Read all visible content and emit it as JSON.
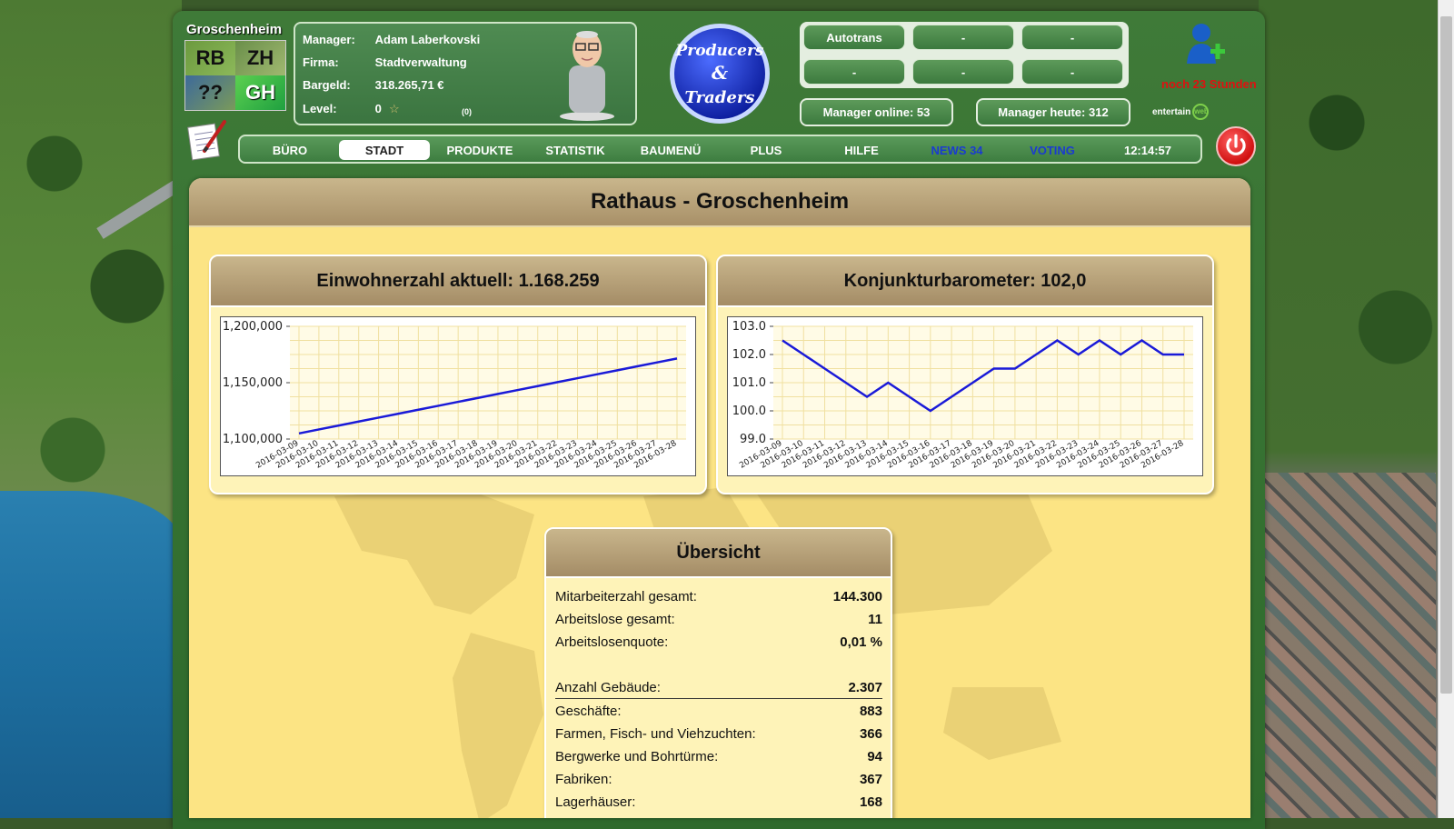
{
  "city": {
    "name": "Groschenheim",
    "grid": [
      "RB",
      "ZH",
      "??",
      "GH"
    ]
  },
  "manager": {
    "manager_label": "Manager:",
    "manager_value": "Adam Laberkovski",
    "firma_label": "Firma:",
    "firma_value": "Stadtverwaltung",
    "bargeld_label": "Bargeld:",
    "bargeld_value": "318.265,71 €",
    "level_label": "Level:",
    "level_value": "0",
    "level_count": "(0)"
  },
  "logo": {
    "line1": "Producers",
    "line2": "&",
    "line3": "Traders"
  },
  "top_buttons": [
    "Autotrans",
    "-",
    "-",
    "-",
    "-",
    "-"
  ],
  "stats": {
    "online_label": "Manager online:",
    "online_value": "53",
    "today_label": "Manager heute:",
    "today_value": "312"
  },
  "countdown": "noch 23 Stunden",
  "entertain": "entertain",
  "entertain_badge": "web",
  "nav": {
    "items": [
      "BÜRO",
      "STADT",
      "PRODUKTE",
      "STATISTIK",
      "BAUMENÜ",
      "PLUS",
      "HILFE",
      "NEWS 34",
      "VOTING"
    ],
    "time": "12:14:57"
  },
  "page_title": "Rathaus - Groschenheim",
  "chart_data": [
    {
      "type": "line",
      "title": "Einwohnerzahl aktuell: 1.168.259",
      "x": [
        "2016-03-09",
        "2016-03-10",
        "2016-03-11",
        "2016-03-12",
        "2016-03-13",
        "2016-03-14",
        "2016-03-15",
        "2016-03-16",
        "2016-03-17",
        "2016-03-18",
        "2016-03-19",
        "2016-03-20",
        "2016-03-21",
        "2016-03-22",
        "2016-03-23",
        "2016-03-24",
        "2016-03-25",
        "2016-03-26",
        "2016-03-27",
        "2016-03-28"
      ],
      "values": [
        1105000,
        1108500,
        1112000,
        1115500,
        1119000,
        1122500,
        1126000,
        1129500,
        1133000,
        1136500,
        1140000,
        1143500,
        1147000,
        1150500,
        1154000,
        1157500,
        1161000,
        1164500,
        1168000,
        1171500
      ],
      "yticks": [
        "1,100,000",
        "1,150,000",
        "1,200,000"
      ],
      "ylim": [
        1100000,
        1200000
      ],
      "grid": true,
      "line_color": "#1a1ad8"
    },
    {
      "type": "line",
      "title": "Konjunkturbarometer: 102,0",
      "x": [
        "2016-03-09",
        "2016-03-10",
        "2016-03-11",
        "2016-03-12",
        "2016-03-13",
        "2016-03-14",
        "2016-03-15",
        "2016-03-16",
        "2016-03-17",
        "2016-03-18",
        "2016-03-19",
        "2016-03-20",
        "2016-03-21",
        "2016-03-22",
        "2016-03-23",
        "2016-03-24",
        "2016-03-25",
        "2016-03-26",
        "2016-03-27",
        "2016-03-28"
      ],
      "values": [
        102.5,
        102.0,
        101.5,
        101.0,
        100.5,
        101.0,
        100.5,
        100.0,
        100.5,
        101.0,
        101.5,
        101.5,
        102.0,
        102.5,
        102.0,
        102.5,
        102.0,
        102.5,
        102.0,
        102.0
      ],
      "yticks": [
        "99.0",
        "100.0",
        "101.0",
        "102.0",
        "103.0"
      ],
      "ylim": [
        99,
        103
      ],
      "grid": true,
      "line_color": "#1a1ad8"
    }
  ],
  "overview": {
    "title": "Übersicht",
    "rows": [
      {
        "label": "Mitarbeiterzahl gesamt:",
        "value": "144.300"
      },
      {
        "label": "Arbeitslose gesamt:",
        "value": "11"
      },
      {
        "label": "Arbeitslosenquote:",
        "value": "0,01 %"
      },
      {
        "label": "Anzahl Gebäude:",
        "value": "2.307"
      },
      {
        "label": "Geschäfte:",
        "value": "883"
      },
      {
        "label": "Farmen, Fisch- und Viehzuchten:",
        "value": "366"
      },
      {
        "label": "Bergwerke und Bohrtürme:",
        "value": "94"
      },
      {
        "label": "Fabriken:",
        "value": "367"
      },
      {
        "label": "Lagerhäuser:",
        "value": "168"
      }
    ]
  },
  "icons": {
    "notepad": "notepad-icon",
    "star": "star-icon",
    "add_user": "add-user-icon",
    "power": "power-icon"
  }
}
